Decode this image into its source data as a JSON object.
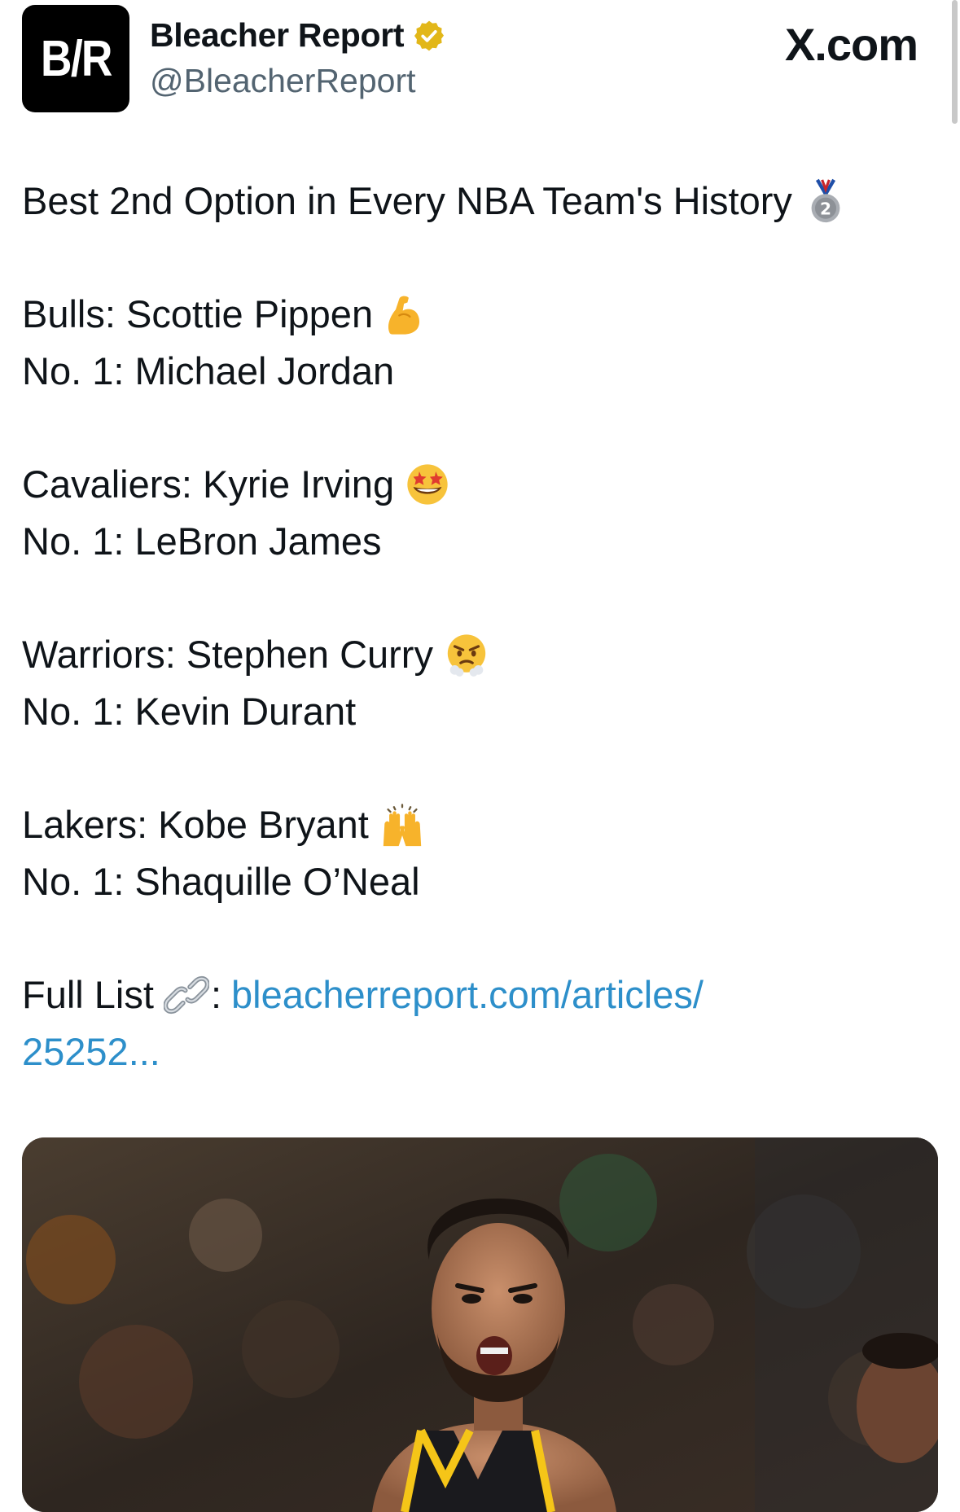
{
  "header": {
    "avatar_text": "B/R",
    "display_name": "Bleacher Report",
    "handle": "@BleacherReport",
    "brand": "X.com",
    "verified_color": "#e2b719"
  },
  "tweet": {
    "title": "Best 2nd Option in Every NBA Team's History",
    "title_emoji": "second-place-medal-icon",
    "entries": [
      {
        "team_line": "Bulls: Scottie Pippen",
        "emoji": "flexed-biceps-icon",
        "no1_line": "No. 1: Michael Jordan"
      },
      {
        "team_line": "Cavaliers: Kyrie Irving",
        "emoji": "star-struck-face-icon",
        "no1_line": "No. 1: LeBron James"
      },
      {
        "team_line": "Warriors: Stephen Curry",
        "emoji": "face-with-steam-icon",
        "no1_line": "No. 1: Kevin Durant"
      },
      {
        "team_line": "Lakers: Kobe Bryant",
        "emoji": "raising-hands-icon",
        "no1_line": "No. 1: Shaquille O’Neal"
      }
    ],
    "full_list_label": "Full List",
    "full_list_emoji": "link-icon",
    "colon": ":",
    "link_line1": "bleacherreport.com/articles/",
    "link_line2": "25252...",
    "link_color": "#2d8fca"
  }
}
